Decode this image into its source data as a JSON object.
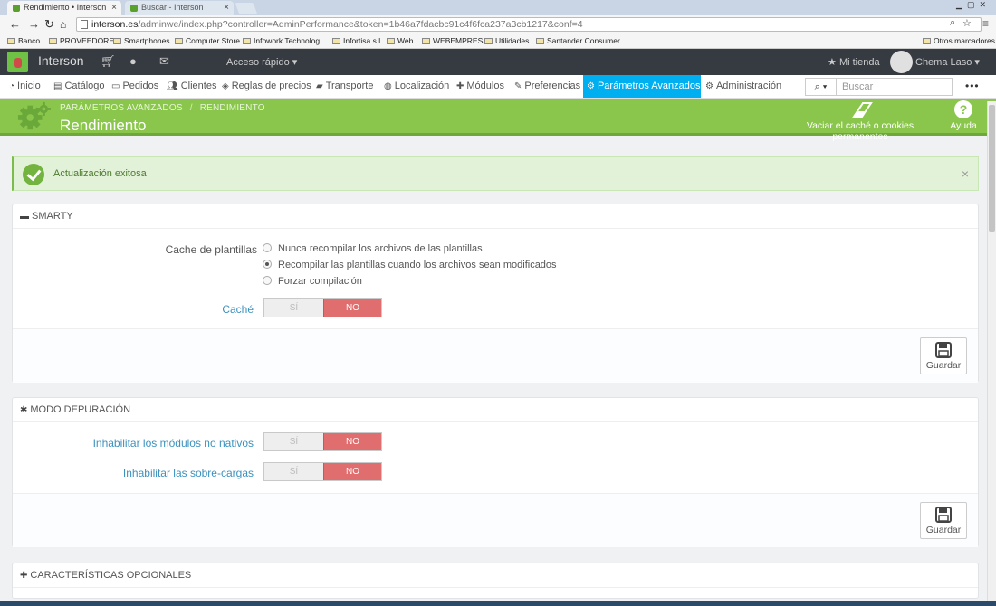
{
  "browser": {
    "tabs": [
      {
        "title": "Rendimiento • Interson",
        "active": true
      },
      {
        "title": "Buscar - Interson",
        "active": false
      }
    ],
    "close_glyph": "×",
    "url_host": "interson.es",
    "url_path": "/adminwe/index.php?controller=AdminPerformance&token=1b46a7fdacbc91c4f6fca237a3cb1217&conf=4",
    "bookmarks": [
      "Banco",
      "PROVEEDORES",
      "Smartphones",
      "Computer Store",
      "Infowork Technolog...",
      "Infortisa s.l.",
      "Web",
      "WEBEMPRESA",
      "Utilidades",
      "Santander Consumer"
    ],
    "other_bookmarks": "Otros marcadores"
  },
  "header": {
    "shop_name": "Interson",
    "quick_access": "Acceso rápido",
    "my_store": "Mi tienda",
    "user": "Chema Laso"
  },
  "nav": {
    "items": [
      {
        "label": "Inicio",
        "icon": "dashboard-icon"
      },
      {
        "label": "Catálogo",
        "icon": "book-icon"
      },
      {
        "label": "Pedidos",
        "icon": "credit-card-icon"
      },
      {
        "label": "Clientes",
        "icon": "users-icon"
      },
      {
        "label": "Reglas de precios",
        "icon": "tag-icon"
      },
      {
        "label": "Transporte",
        "icon": "truck-icon"
      },
      {
        "label": "Localización",
        "icon": "globe-icon"
      },
      {
        "label": "Módulos",
        "icon": "puzzle-icon"
      },
      {
        "label": "Preferencias",
        "icon": "wrench-icon"
      },
      {
        "label": "Parámetros Avanzados",
        "icon": "cogs-icon",
        "active": true
      },
      {
        "label": "Administración",
        "icon": "gear-icon"
      }
    ],
    "search_placeholder": "Buscar"
  },
  "toolbar": {
    "breadcrumb": [
      "PARÁMETROS AVANZADOS",
      "RENDIMIENTO"
    ],
    "title": "Rendimiento",
    "clear_cache": "Vaciar el caché o cookies permanentes",
    "help": "Ayuda"
  },
  "alert": {
    "message": "Actualización exitosa",
    "close": "×"
  },
  "smarty": {
    "title": "SMARTY",
    "template_cache_label": "Cache de plantillas",
    "options": [
      {
        "label": "Nunca recompilar los archivos de las plantillas",
        "selected": false
      },
      {
        "label": "Recompilar las plantillas cuando los archivos sean modificados",
        "selected": true
      },
      {
        "label": "Forzar compilación",
        "selected": false
      }
    ],
    "cache_label": "Caché",
    "save": "Guardar"
  },
  "debug": {
    "title": "MODO DEPURACIÓN",
    "disable_non_native": "Inhabilitar los módulos no nativos",
    "disable_overrides": "Inhabilitar las sobre-cargas",
    "save": "Guardar"
  },
  "switch": {
    "yes": "SÍ",
    "no": "NO"
  },
  "optional": {
    "title": "CARACTERÍSTICAS OPCIONALES"
  },
  "colors": {
    "header": "#363a41",
    "toolbar": "#8ac64b",
    "active_nav": "#00aff0",
    "switch_no": "#e06e6e",
    "success": "#73b340"
  }
}
